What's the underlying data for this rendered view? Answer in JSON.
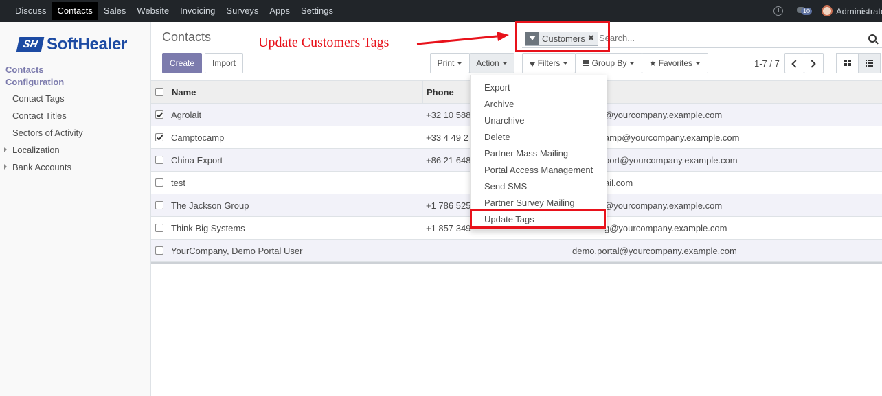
{
  "topbar": {
    "menu": [
      "Discuss",
      "Contacts",
      "Sales",
      "Website",
      "Invoicing",
      "Surveys",
      "Apps",
      "Settings"
    ],
    "active": "Contacts",
    "chat_count": "10",
    "user": "Administrator"
  },
  "sidebar": {
    "logo_mark": "SH",
    "logo_text": "SoftHealer",
    "section1": "Contacts",
    "section2": "Configuration",
    "items": [
      "Contact Tags",
      "Contact Titles",
      "Sectors of Activity"
    ],
    "collapsible": [
      "Localization",
      "Bank Accounts"
    ]
  },
  "control": {
    "breadcrumb": "Contacts",
    "annotation": "Update Customers Tags",
    "create_label": "Create",
    "import_label": "Import",
    "print_label": "Print",
    "action_label": "Action",
    "filters_label": "Filters",
    "groupby_label": "Group By",
    "favorites_label": "Favorites",
    "facet_label": "Customers",
    "search_placeholder": "Search...",
    "pager": "1-7 / 7"
  },
  "table": {
    "headers": [
      "Name",
      "Phone"
    ],
    "rows": [
      {
        "name": "Agrolait",
        "phone": "+32 10 588",
        "email": "@yourcompany.example.com",
        "checked": true
      },
      {
        "name": "Camptocamp",
        "phone": "+33 4 49 2",
        "email": "amp@yourcompany.example.com",
        "checked": true
      },
      {
        "name": "China Export",
        "phone": "+86 21 648",
        "email": "port@yourcompany.example.com",
        "checked": false
      },
      {
        "name": "test",
        "phone": "",
        "email": "ail.com",
        "checked": false
      },
      {
        "name": "The Jackson Group",
        "phone": "+1 786 525",
        "email": "@yourcompany.example.com",
        "checked": false
      },
      {
        "name": "Think Big Systems",
        "phone": "+1 857 349",
        "email": "g@yourcompany.example.com",
        "checked": false
      },
      {
        "name": "YourCompany, Demo Portal User",
        "phone": "",
        "email": "demo.portal@yourcompany.example.com",
        "checked": false
      }
    ]
  },
  "action_menu": [
    "Export",
    "Archive",
    "Unarchive",
    "Delete",
    "Partner Mass Mailing",
    "Portal Access Management",
    "Send SMS",
    "Partner Survey Mailing",
    "Update Tags"
  ],
  "colors": {
    "accent": "#7c7bad",
    "annotation": "#e8121b",
    "brand": "#1d4ba3"
  }
}
